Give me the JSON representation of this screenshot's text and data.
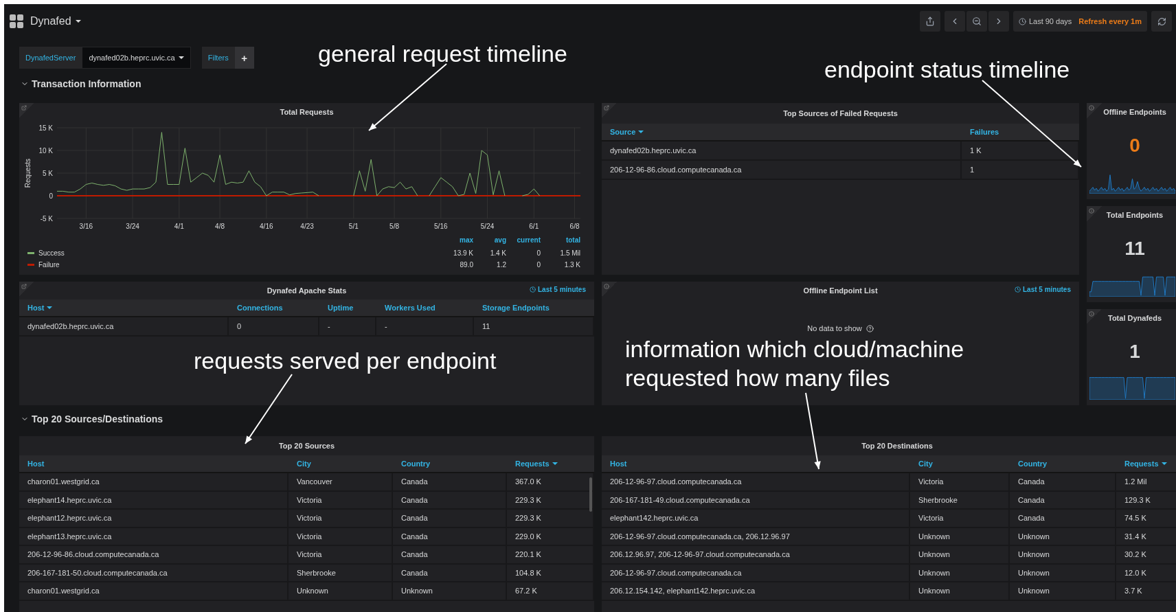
{
  "top_bar": {
    "dashboard_title": "Dynafed",
    "time_range": "Last 90 days",
    "refresh": "Refresh every 1m"
  },
  "variables": [
    {
      "label": "DynafedServer",
      "value": "dynafed02b.heprc.uvic.ca"
    }
  ],
  "filters": {
    "label": "Filters",
    "add": "+"
  },
  "sections": [
    {
      "title": "Transaction Information",
      "expanded": true
    },
    {
      "title": "Top 20 Sources/Destinations",
      "expanded": true
    }
  ],
  "total_requests": {
    "title": "Total Requests",
    "chart_data": {
      "type": "line",
      "ylabel": "Requests",
      "ylim": [
        -5,
        15
      ],
      "grid": true,
      "categories": [
        null,
        null,
        null,
        null,
        null,
        "3/16",
        null,
        null,
        null,
        null,
        null,
        null,
        null,
        "3/24",
        null,
        null,
        null,
        null,
        null,
        null,
        null,
        "4/1",
        null,
        null,
        null,
        null,
        null,
        null,
        "4/8",
        null,
        null,
        null,
        null,
        null,
        null,
        null,
        "4/16",
        null,
        null,
        null,
        null,
        null,
        null,
        "4/23",
        null,
        null,
        null,
        null,
        null,
        null,
        null,
        "5/1",
        null,
        null,
        null,
        null,
        null,
        null,
        "5/8",
        null,
        null,
        null,
        null,
        null,
        null,
        null,
        "5/16",
        null,
        null,
        null,
        null,
        null,
        null,
        null,
        "5/24",
        null,
        null,
        null,
        null,
        null,
        null,
        null,
        "6/1",
        null,
        null,
        null,
        null,
        null,
        null,
        "6/8",
        null
      ],
      "yticks": [
        {
          "value": 15,
          "label": "15 K"
        },
        {
          "value": 10,
          "label": "10 K"
        },
        {
          "value": 5,
          "label": "5 K"
        },
        {
          "value": 0,
          "label": "0"
        },
        {
          "value": -5,
          "label": "-5 K"
        }
      ],
      "series": [
        {
          "name": "Success",
          "color": "#7eb26d",
          "values": [
            1,
            1,
            0.8,
            0.8,
            1.5,
            2.5,
            2.8,
            2.5,
            2.3,
            2.5,
            2.2,
            1.5,
            1.2,
            1.5,
            1.5,
            1.5,
            1.8,
            3,
            14,
            2.5,
            2.5,
            2.5,
            10.5,
            3,
            4,
            5,
            4.5,
            3,
            9,
            2.5,
            3,
            2.8,
            3,
            5.5,
            3,
            2,
            0,
            0.8,
            0.8,
            0.8,
            0.2,
            0.5,
            0.6,
            0.7,
            0.8,
            0,
            null,
            null,
            null,
            null,
            null,
            0,
            5.5,
            1,
            8,
            0,
            1.5,
            2,
            1.8,
            3,
            1.5,
            2,
            0,
            null,
            0,
            2,
            4,
            3,
            2,
            0,
            0.3,
            5,
            0.5,
            10,
            9,
            0.2,
            5.5,
            0,
            null,
            null,
            0,
            0.3,
            1.5,
            0,
            null,
            null,
            null,
            null,
            null,
            null,
            null
          ]
        },
        {
          "name": "Failure",
          "color": "#bf1b00",
          "values": [
            0,
            0,
            0,
            0,
            0,
            0,
            0,
            0,
            0,
            0,
            0,
            0,
            0,
            0,
            0,
            0,
            0,
            0,
            0,
            0,
            0,
            0,
            0,
            0,
            0,
            0,
            0,
            0,
            0,
            0,
            0,
            0,
            0,
            0,
            0,
            0,
            0,
            0,
            0,
            0,
            0,
            0,
            0,
            0,
            0,
            0,
            0,
            0,
            0,
            0,
            0,
            0,
            0,
            0,
            0,
            0,
            0,
            0,
            0,
            0,
            0,
            0,
            0,
            0,
            0,
            0,
            0,
            0,
            0,
            0,
            0,
            0,
            0,
            0,
            0,
            0,
            0,
            0,
            0,
            0,
            0,
            0,
            0,
            0,
            0,
            0,
            0,
            0,
            0,
            0,
            0
          ]
        }
      ]
    },
    "legend": {
      "columns": [
        "max",
        "avg",
        "current",
        "total"
      ],
      "rows": [
        [
          "13.9 K",
          "1.4 K",
          "0",
          "1.5 Mil"
        ],
        [
          "89.0",
          "1.2",
          "0",
          "1.3 K"
        ]
      ]
    }
  },
  "failed_requests": {
    "title": "Top Sources of Failed Requests",
    "columns": [
      {
        "label": "Source",
        "sorted": true
      },
      {
        "label": "Failures",
        "sorted": false
      }
    ],
    "rows": [
      [
        "dynafed02b.heprc.uvic.ca",
        "1 K"
      ],
      [
        "206-12-96-86.cloud.computecanada.ca",
        "1"
      ]
    ]
  },
  "stats": [
    {
      "title": "Offline Endpoints",
      "value": "0",
      "alert": true
    },
    {
      "title": "Total Endpoints",
      "value": "11",
      "alert": false
    },
    {
      "title": "Total Dynafeds",
      "value": "1",
      "alert": false
    }
  ],
  "apache_stats": {
    "title": "Dynafed Apache Stats",
    "time_info": "Last 5 minutes",
    "columns": [
      {
        "label": "Host",
        "sorted": true
      },
      {
        "label": "Connections",
        "sorted": false
      },
      {
        "label": "Uptime",
        "sorted": false
      },
      {
        "label": "Workers Used",
        "sorted": false
      },
      {
        "label": "Storage Endpoints",
        "sorted": false
      }
    ],
    "rows": [
      [
        "dynafed02b.heprc.uvic.ca",
        "0",
        "-",
        "-",
        "11"
      ]
    ]
  },
  "offline_list": {
    "title": "Offline Endpoint List",
    "time_info": "Last 5 minutes",
    "empty_text": "No data to show"
  },
  "sources": {
    "title": "Top 20 Sources",
    "columns": [
      {
        "label": "Host",
        "sorted": false
      },
      {
        "label": "City",
        "sorted": false
      },
      {
        "label": "Country",
        "sorted": false
      },
      {
        "label": "Requests",
        "sorted": true
      }
    ],
    "rows": [
      [
        "charon01.westgrid.ca",
        "Vancouver",
        "Canada",
        "367.0 K"
      ],
      [
        "elephant14.heprc.uvic.ca",
        "Victoria",
        "Canada",
        "229.3 K"
      ],
      [
        "elephant12.heprc.uvic.ca",
        "Victoria",
        "Canada",
        "229.3 K"
      ],
      [
        "elephant13.heprc.uvic.ca",
        "Victoria",
        "Canada",
        "229.0 K"
      ],
      [
        "206-12-96-86.cloud.computecanada.ca",
        "Victoria",
        "Canada",
        "220.1 K"
      ],
      [
        "206-167-181-50.cloud.computecanada.ca",
        "Sherbrooke",
        "Canada",
        "104.8 K"
      ],
      [
        "charon01.westgrid.ca",
        "Unknown",
        "Unknown",
        "67.2 K"
      ]
    ]
  },
  "destinations": {
    "title": "Top 20 Destinations",
    "columns": [
      {
        "label": "Host",
        "sorted": false
      },
      {
        "label": "City",
        "sorted": false
      },
      {
        "label": "Country",
        "sorted": false
      },
      {
        "label": "Requests",
        "sorted": true
      }
    ],
    "rows": [
      [
        "206-12-96-97.cloud.computecanada.ca",
        "Victoria",
        "Canada",
        "1.2 Mil"
      ],
      [
        "206-167-181-49.cloud.computecanada.ca",
        "Sherbrooke",
        "Canada",
        "129.3 K"
      ],
      [
        "elephant142.heprc.uvic.ca",
        "Victoria",
        "Canada",
        "74.5 K"
      ],
      [
        "206-12-96-97.cloud.computecanada.ca, 206.12.96.97",
        "Unknown",
        "Unknown",
        "31.4 K"
      ],
      [
        "206.12.96.97, 206-12-96-97.cloud.computecanada.ca",
        "Unknown",
        "Unknown",
        "30.2 K"
      ],
      [
        "206-12-96-97.cloud.computecanada.ca",
        "Unknown",
        "Unknown",
        "12.0 K"
      ],
      [
        "206.12.154.142, elephant142.heprc.uvic.ca",
        "Unknown",
        "Unknown",
        "3.7 K"
      ]
    ]
  },
  "annotations": [
    {
      "text": "general request timeline"
    },
    {
      "text": "endpoint status timeline"
    },
    {
      "text": "requests served per endpoint"
    },
    {
      "text": "information which cloud/machine requested how many files"
    }
  ]
}
